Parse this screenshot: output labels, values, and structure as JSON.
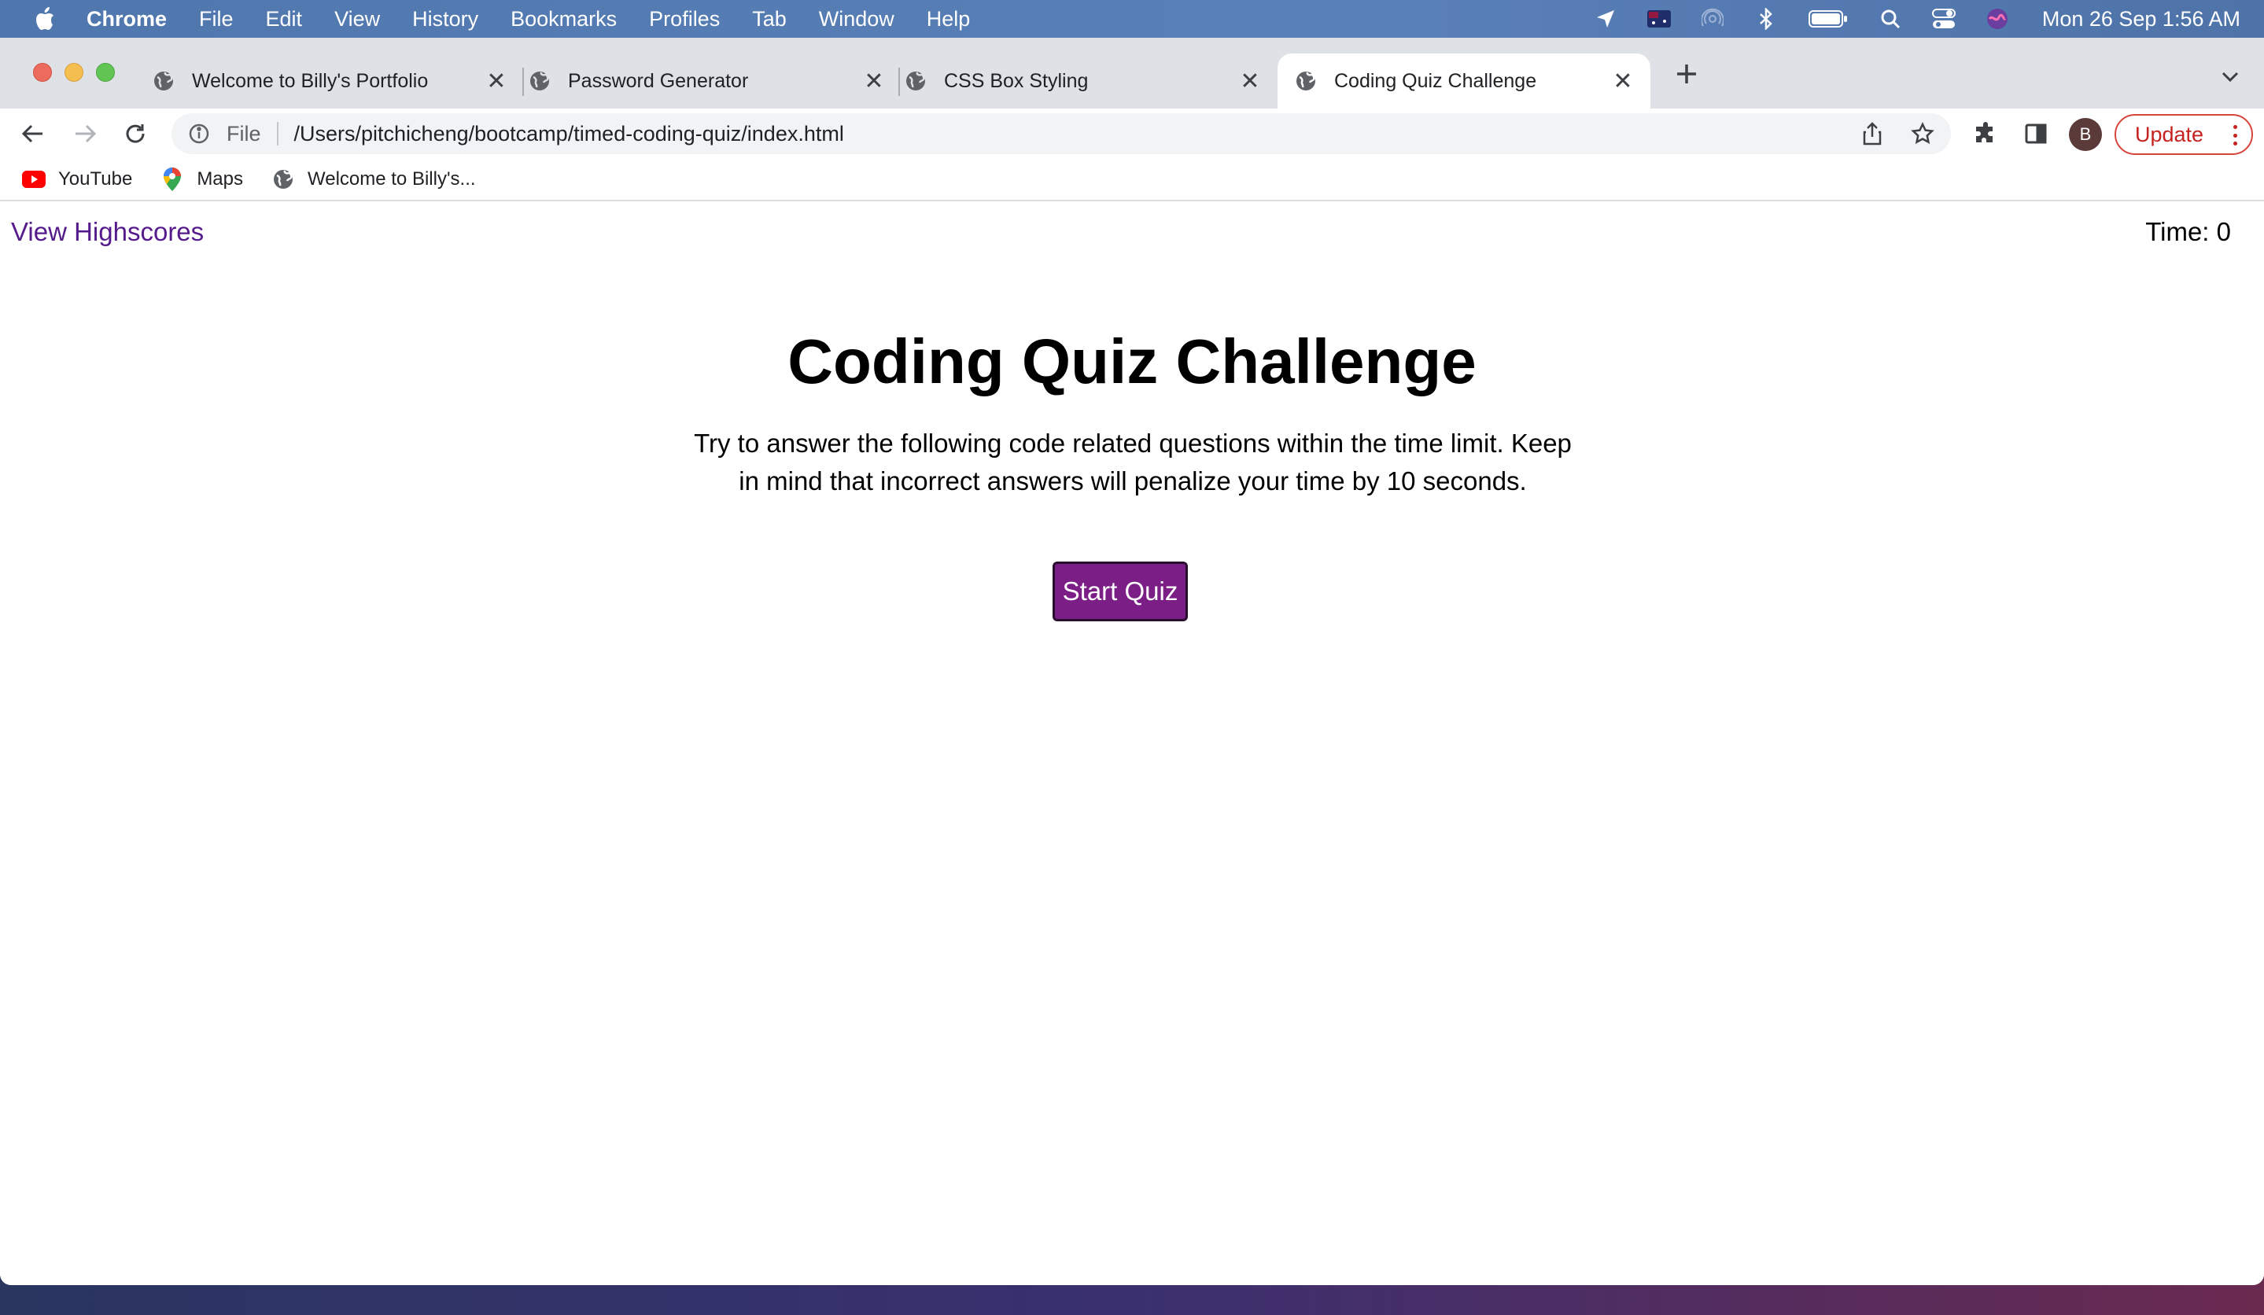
{
  "menubar": {
    "app": "Chrome",
    "items": [
      "File",
      "Edit",
      "View",
      "History",
      "Bookmarks",
      "Profiles",
      "Tab",
      "Window",
      "Help"
    ],
    "clock": "Mon 26 Sep  1:56 AM"
  },
  "tabs": [
    {
      "title": "Welcome to Billy's Portfolio",
      "active": false
    },
    {
      "title": "Password Generator",
      "active": false
    },
    {
      "title": "CSS Box Styling",
      "active": false
    },
    {
      "title": "Coding Quiz Challenge",
      "active": true
    }
  ],
  "omnibox": {
    "scheme_label": "File",
    "url": "/Users/pitchicheng/bootcamp/timed-coding-quiz/index.html"
  },
  "toolbar": {
    "profile_initial": "B",
    "update_label": "Update"
  },
  "bookmarks": [
    {
      "label": "YouTube",
      "icon": "youtube-icon"
    },
    {
      "label": "Maps",
      "icon": "maps-icon"
    },
    {
      "label": "Welcome to Billy's...",
      "icon": "globe-icon"
    }
  ],
  "page": {
    "highscores_link": "View Highscores",
    "timer": "Time: 0",
    "title": "Coding Quiz Challenge",
    "description": "Try to answer the following code related questions within the time limit. Keep in mind that incorrect answers will penalize your time by 10 seconds.",
    "start_button": "Start Quiz"
  },
  "colors": {
    "link": "#551a8b",
    "button": "#7b1f86",
    "update": "#c5221f"
  }
}
